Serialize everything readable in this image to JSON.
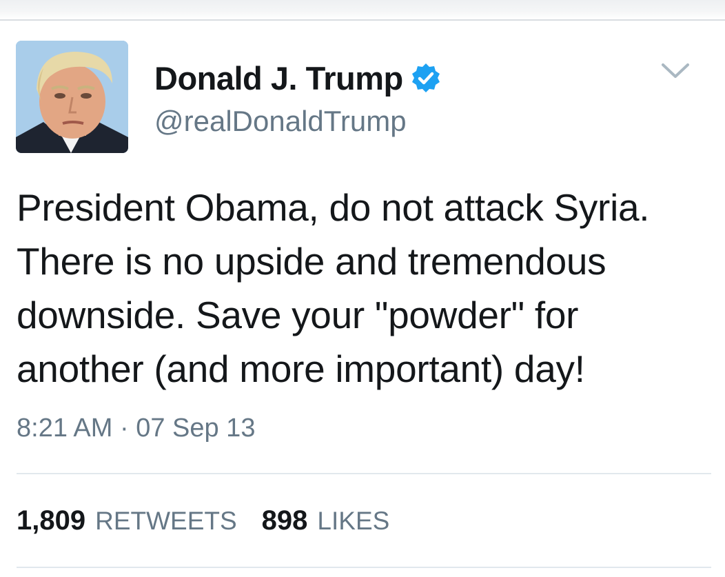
{
  "tweet": {
    "author": {
      "display_name": "Donald J. Trump",
      "handle": "@realDonaldTrump",
      "verified": true,
      "avatar_icon": "profile-photo"
    },
    "text": "President Obama, do not attack Syria.\nThere is no upside and tremendous\ndownside. Save your \"powder\" for\nanother (and more important) day!",
    "timestamp": "8:21 AM · 07 Sep 13",
    "stats": {
      "retweets_count": "1,809",
      "retweets_label": "RETWEETS",
      "likes_count": "898",
      "likes_label": "LIKES"
    }
  },
  "colors": {
    "verified_badge": "#1da1f2",
    "secondary_text": "#657786",
    "divider": "#e1e8ed"
  }
}
